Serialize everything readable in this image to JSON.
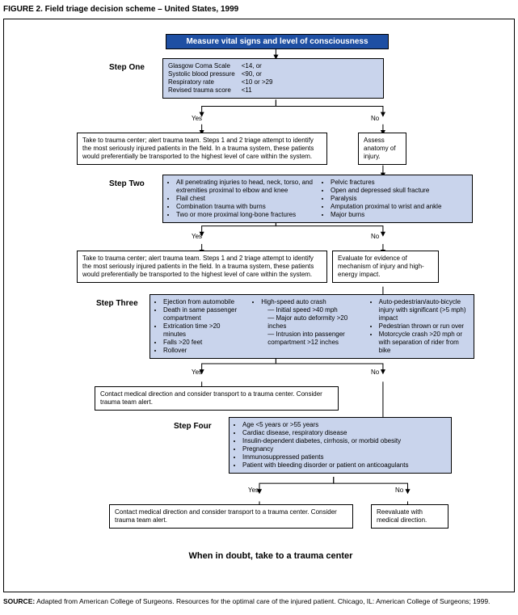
{
  "figure_title": "FIGURE 2. Field triage decision scheme – United States, 1999",
  "header": "Measure vital signs and level of consciousness",
  "steps": {
    "one": {
      "label": "Step One"
    },
    "two": {
      "label": "Step Two"
    },
    "three": {
      "label": "Step Three"
    },
    "four": {
      "label": "Step Four"
    }
  },
  "vitals": {
    "r1l": "Glasgow Coma Scale",
    "r1r": "<14, or",
    "r2l": "Systolic blood pressure",
    "r2r": "<90, or",
    "r3l": "Respiratory rate",
    "r3r": "<10 or >29",
    "r4l": "Revised trauma score",
    "r4r": "<11"
  },
  "yn": {
    "yes": "Yes",
    "no": "No"
  },
  "boxes": {
    "s1_yes": "Take to trauma center; alert trauma team. Steps 1 and 2 triage attempt to identify the most seriously injured patients in the field. In a trauma system, these patients would preferentially be transported to the highest level of care within the system.",
    "s1_no": "Assess anatomy of injury.",
    "s2_yes": "Take to trauma center; alert trauma team. Steps 1 and 2 triage attempt to identify the most seriously injured patients in the field. In a trauma system, these patients would preferentially be transported to the highest level of care within the system.",
    "s2_no": "Evaluate for evidence of mechanism of injury and high-energy impact.",
    "s3_yes": "Contact medical direction and consider transport to a trauma center. Consider trauma team alert.",
    "s4_yes": "Contact medical direction and consider transport to a trauma center. Consider trauma team alert.",
    "s4_no": "Reevaluate with medical direction."
  },
  "step2_crit": {
    "l1": "All penetrating injuries to head, neck, torso, and extremities proximal to elbow and knee",
    "l2": "Flail chest",
    "l3": "Combination trauma with burns",
    "l4": "Two or more proximal long-bone fractures",
    "r1": "Pelvic fractures",
    "r2": "Open and depressed skull fracture",
    "r3": "Paralysis",
    "r4": "Amputation proximal to wrist and ankle",
    "r5": "Major burns"
  },
  "step3_crit": {
    "a1": "Ejection from automobile",
    "a2": "Death in same passenger compartment",
    "a3": "Extrication time >20 minutes",
    "a4": "Falls >20 feet",
    "a5": "Rollover",
    "b1": "High-speed auto crash",
    "b1s1": "Initial speed >40 mph",
    "b1s2": "Major auto deformity >20 inches",
    "b1s3": "Intrusion into passenger compartment >12 inches",
    "c1": "Auto-pedestrian/auto-bicycle injury with significant (>5 mph) impact",
    "c2": "Pedestrian thrown or run over",
    "c3": "Motorcycle crash >20 mph or with separation of rider from bike"
  },
  "step4_crit": {
    "i1": "Age <5 years or >55 years",
    "i2": "Cardiac disease, respiratory disease",
    "i3": "Insulin-dependent diabetes, cirrhosis, or morbid obesity",
    "i4": "Pregnancy",
    "i5": "Immunosuppressed patients",
    "i6": "Patient with bleeding disorder or patient on anticoagulants"
  },
  "doubt": "When in doubt, take to a trauma center",
  "source_label": "SOURCE:",
  "source_text": " Adapted from American College of Surgeons. Resources for the optimal care of the injured patient. Chicago, IL: American College of Surgeons; 1999."
}
